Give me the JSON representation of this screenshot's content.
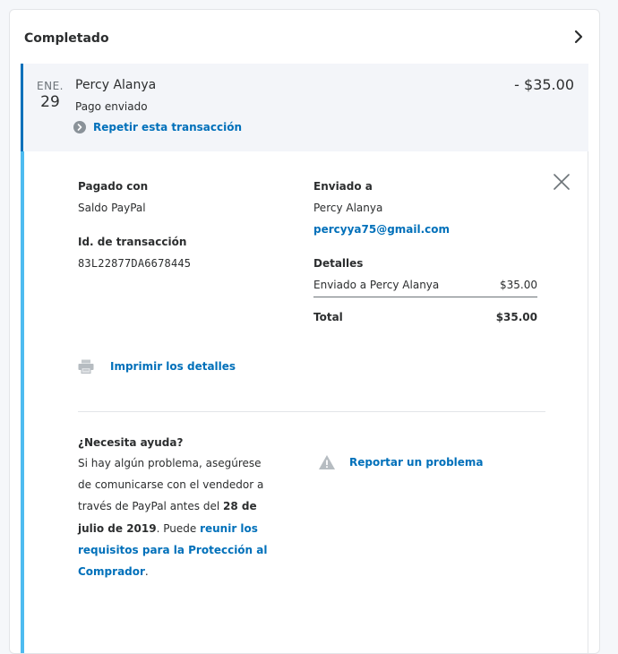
{
  "section": {
    "title": "Completado"
  },
  "transaction": {
    "month": "ENE.",
    "day": "29",
    "name": "Percy Alanya",
    "status": "Pago enviado",
    "repeat_label": "Repetir esta transacción",
    "amount": "- $35.00"
  },
  "details": {
    "paid_with_label": "Pagado con",
    "paid_with_value": "Saldo PayPal",
    "txn_id_label": "Id. de transacción",
    "txn_id_value": "83L22877DA6678445",
    "sent_to_label": "Enviado a",
    "sent_to_name": "Percy Alanya",
    "sent_to_email": "percyya75@gmail.com",
    "breakdown_label": "Detalles",
    "breakdown_item": "Enviado a Percy Alanya",
    "breakdown_item_amount": "$35.00",
    "total_label": "Total",
    "total_amount": "$35.00",
    "print_label": "Imprimir los detalles"
  },
  "help": {
    "title": "¿Necesita ayuda?",
    "text_1": "Si hay algún problema, asegúrese de comunicarse con el vendedor a través de PayPal antes del ",
    "deadline": "28 de julio de 2019",
    "text_2": ". Puede ",
    "link": "reunir los requisitos para la Protección al Comprador",
    "text_3": ".",
    "report_label": "Reportar un problema"
  },
  "colors": {
    "link_blue": "#0070ba",
    "accent_bar": "#4ebbf0",
    "summary_bg": "#f3f5f9"
  }
}
